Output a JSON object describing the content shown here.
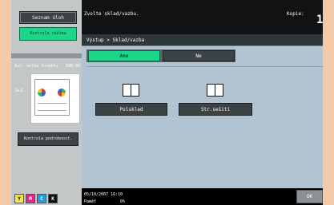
{
  "header": {
    "title": "Zvolte sklad/vazbu.",
    "copies_label": "Kopie:",
    "copies_value": "1"
  },
  "left": {
    "job_list_label": "Seznam úloh",
    "check_mode_label": "Kontrola režimu",
    "meta_label": "Aut. volba formátu",
    "meta_value": "100.0%",
    "side_indicator": "1▸2",
    "check_details_label": "Kontrola podrobnost.",
    "toner": [
      "Y",
      "M",
      "C",
      "K"
    ]
  },
  "main": {
    "breadcrumb": "Výstup > Sklad/vazba",
    "tabs": [
      {
        "label": "Ano",
        "selected": true
      },
      {
        "label": "Ne",
        "selected": false
      }
    ],
    "options": [
      {
        "label": "Polsklad",
        "icon": "book-icon"
      },
      {
        "label": "Str.sešití",
        "icon": "book-icon"
      }
    ]
  },
  "footer": {
    "date": "05/10/2007  16:10",
    "memory_label": "Paměť",
    "memory_value": "0%",
    "ok_label": "OK"
  },
  "colors": {
    "accent_green": "#1ad68a",
    "panel_bg": "#b2c4d1",
    "frame": "#f3c9a7"
  }
}
